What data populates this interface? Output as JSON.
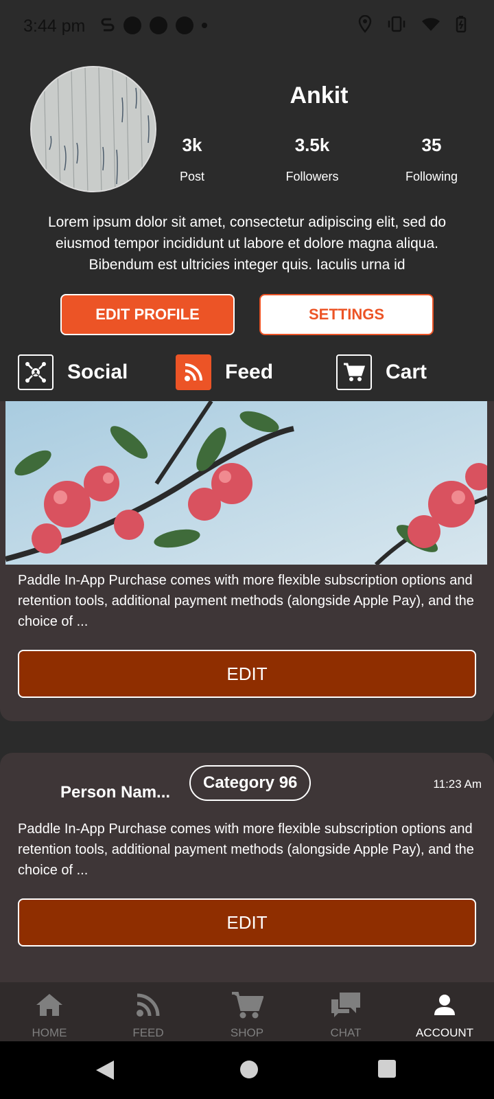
{
  "status_bar": {
    "time": "3:44 pm"
  },
  "profile": {
    "name": "Ankit",
    "stats": [
      {
        "value": "3k",
        "label": "Post"
      },
      {
        "value": "3.5k",
        "label": "Followers"
      },
      {
        "value": "35",
        "label": "Following"
      }
    ],
    "bio": "Lorem ipsum dolor sit amet, consectetur adipiscing elit, sed do eiusmod tempor incididunt ut labore et dolore magna aliqua. Bibendum est ultricies integer quis. Iaculis urna id",
    "edit_profile_label": "EDIT PROFILE",
    "settings_label": "SETTINGS"
  },
  "tabs": [
    {
      "label": "Social",
      "icon": "social-icon",
      "active": false
    },
    {
      "label": "Feed",
      "icon": "rss-icon",
      "active": true
    },
    {
      "label": "Cart",
      "icon": "cart-icon",
      "active": false
    }
  ],
  "posts": [
    {
      "text": "Paddle In-App Purchase comes with more flexible subscription options and retention tools, additional payment methods (alongside Apple Pay), and the choice of ...",
      "edit_label": "EDIT"
    },
    {
      "person_name": "Person Nam...",
      "category": "Category 96",
      "time": "11:23 Am",
      "text": "Paddle In-App Purchase comes with more flexible subscription options and retention tools, additional payment methods (alongside Apple Pay), and the choice of ...",
      "edit_label": "EDIT"
    }
  ],
  "bottom_nav": [
    {
      "label": "HOME",
      "icon": "home-icon",
      "active": false
    },
    {
      "label": "FEED",
      "icon": "rss-icon",
      "active": false
    },
    {
      "label": "SHOP",
      "icon": "cart-icon",
      "active": false
    },
    {
      "label": "CHAT",
      "icon": "chat-icon",
      "active": false
    },
    {
      "label": "ACCOUNT",
      "icon": "person-icon",
      "active": true
    }
  ],
  "colors": {
    "accent": "#ec5426",
    "edit_button": "#8f2e00",
    "card": "#3e3637",
    "background": "#2b2b2b"
  }
}
